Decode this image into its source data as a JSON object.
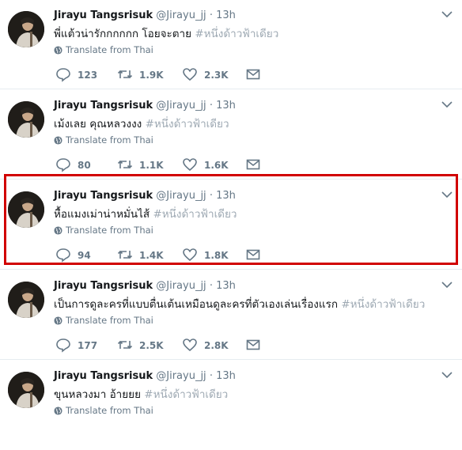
{
  "feed": {
    "translate_label": "Translate from Thai",
    "tweets": [
      {
        "name": "Jirayu Tangsrisuk",
        "handle": "@Jirayu_jj",
        "time": "13h",
        "text": "พี่แต้วน่ารักกกกกก โอยจะตาย",
        "hashtag": "#หนึ่งด้าวฟ้าเดียว",
        "replies": "123",
        "retweets": "1.9K",
        "likes": "2.3K"
      },
      {
        "name": "Jirayu Tangsrisuk",
        "handle": "@Jirayu_jj",
        "time": "13h",
        "text": "เม้งเลย คุณหลวงงง",
        "hashtag": "#หนึ่งด้าวฟ้าเดียว",
        "replies": "80",
        "retweets": "1.1K",
        "likes": "1.6K"
      },
      {
        "name": "Jirayu Tangsrisuk",
        "handle": "@Jirayu_jj",
        "time": "13h",
        "text": "หื้อแมงเม่าน่าหมั่นไส้",
        "hashtag": "#หนึ่งด้าวฟ้าเดียว",
        "replies": "94",
        "retweets": "1.4K",
        "likes": "1.8K"
      },
      {
        "name": "Jirayu Tangsrisuk",
        "handle": "@Jirayu_jj",
        "time": "13h",
        "text": "เป็นการดูละครที่แบบตื่นเต้นเหมือนดูละครที่ตัวเองเล่นเรื่องแรก",
        "hashtag": "#หนึ่งด้าวฟ้าเดียว",
        "replies": "177",
        "retweets": "2.5K",
        "likes": "2.8K"
      },
      {
        "name": "Jirayu Tangsrisuk",
        "handle": "@Jirayu_jj",
        "time": "13h",
        "text": "ขุนหลวงมา อ้ายยย",
        "hashtag": "#หนึ่งด้าวฟ้าเดียว"
      }
    ]
  },
  "icons": {
    "avatar": "profile-photo",
    "caret": "chevron-down-icon",
    "globe": "globe-icon",
    "reply": "reply-icon",
    "retweet": "retweet-icon",
    "like": "heart-icon",
    "dm": "envelope-icon"
  },
  "colors": {
    "highlight_border": "#d10000",
    "hashtag": "#9ea9b3",
    "meta": "#657786"
  }
}
